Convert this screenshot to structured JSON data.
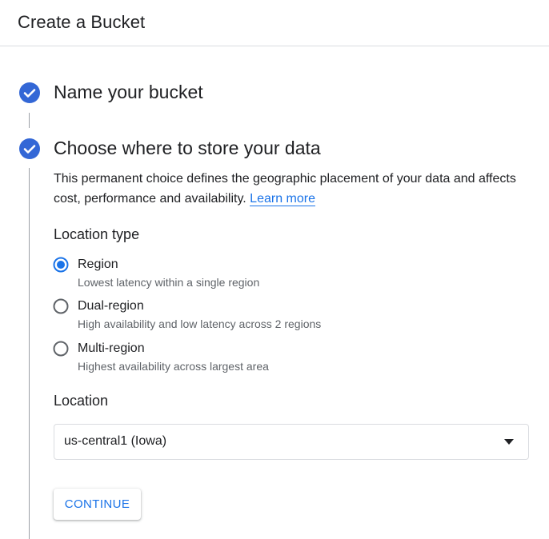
{
  "header": {
    "title": "Create a Bucket"
  },
  "steps": [
    {
      "title": "Name your bucket",
      "status": "completed"
    },
    {
      "title": "Choose where to store your data",
      "status": "completed"
    }
  ],
  "location_step": {
    "description": "This permanent choice defines the geographic placement of your data and affects cost, performance and availability.",
    "learn_more_label": "Learn more",
    "location_type_label": "Location type",
    "options": [
      {
        "label": "Region",
        "help": "Lowest latency within a single region",
        "selected": true
      },
      {
        "label": "Dual-region",
        "help": "High availability and low latency across 2 regions",
        "selected": false
      },
      {
        "label": "Multi-region",
        "help": "Highest availability across largest area",
        "selected": false
      }
    ],
    "location_label": "Location",
    "location_value": "us-central1 (Iowa)",
    "continue_label": "CONTINUE"
  },
  "colors": {
    "accent": "#1a73e8",
    "check_fill": "#3367d6",
    "text": "#202124",
    "secondary_text": "#5f6368",
    "border": "#dadce0"
  },
  "icons": {
    "step_complete": "check-circle-icon",
    "dropdown": "caret-down-icon"
  }
}
